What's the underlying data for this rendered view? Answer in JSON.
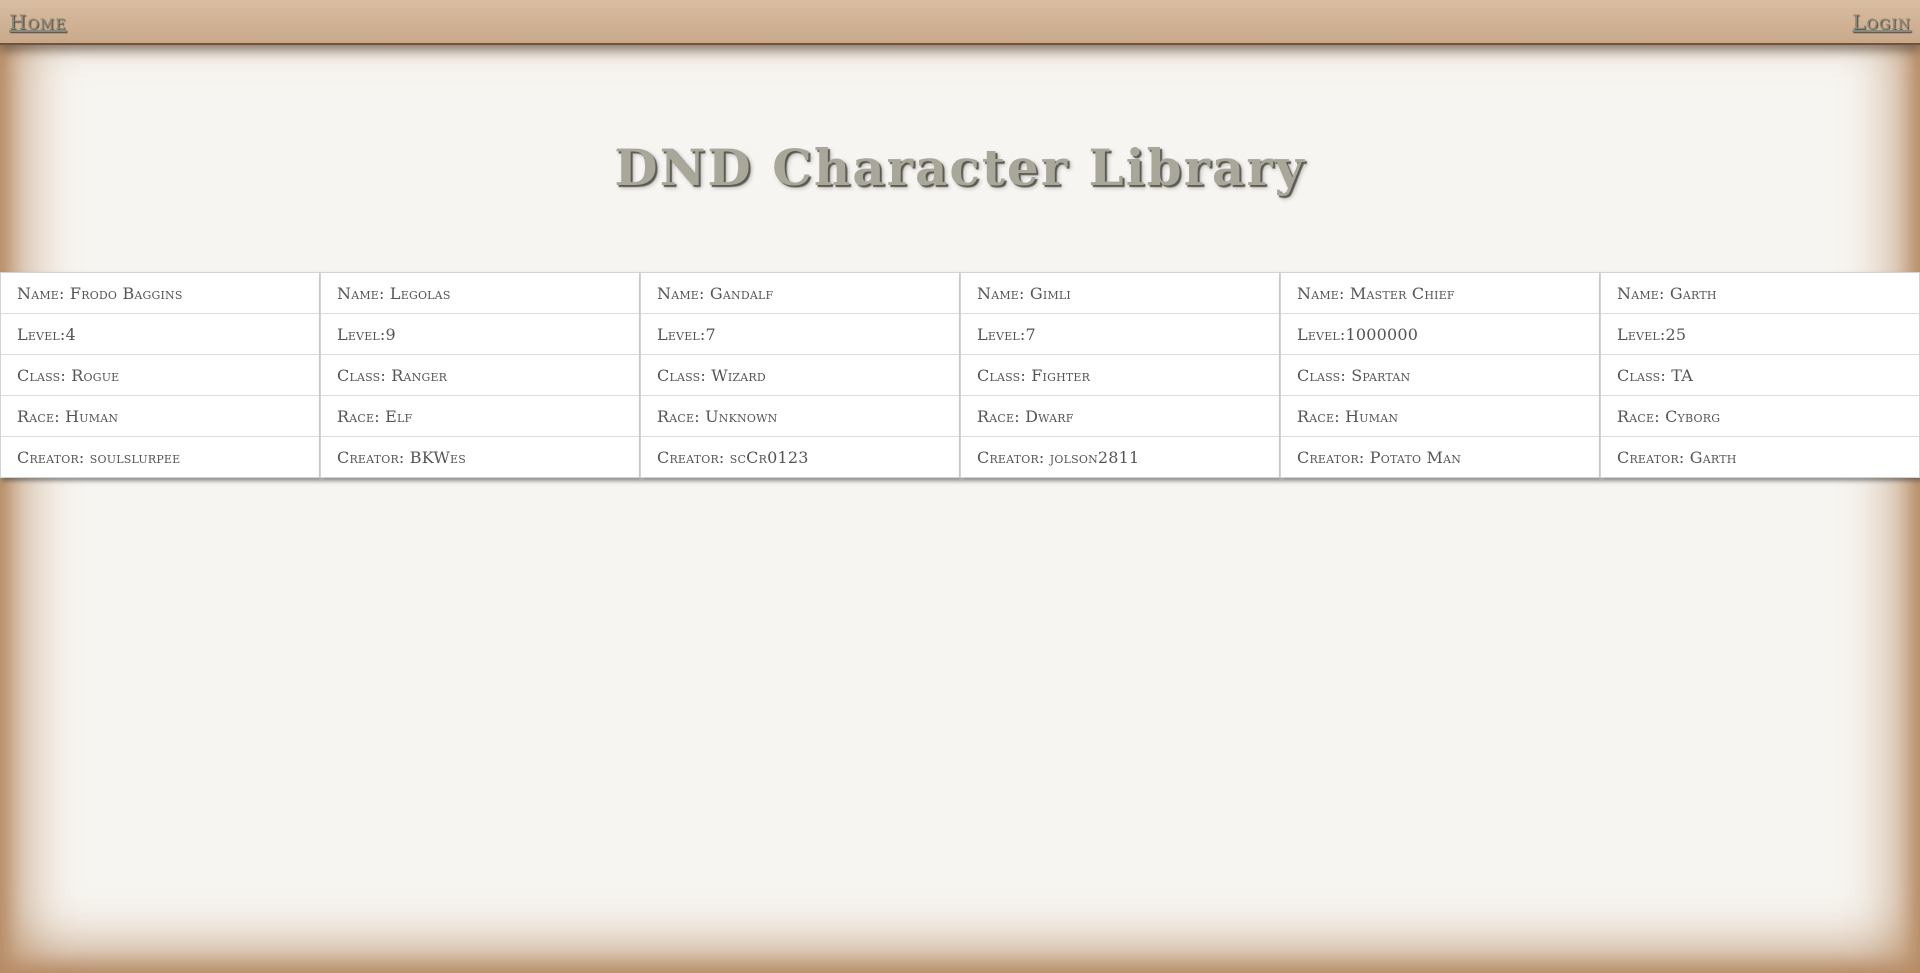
{
  "nav": {
    "home_label": "Home",
    "login_label": "Login"
  },
  "page": {
    "title": "DND Character Library"
  },
  "characters": [
    {
      "name": "Name: Frodo Baggins",
      "level": "Level:4",
      "class": "Class: Rogue",
      "race": "Race: Human",
      "creator": "Creator: soulslurpee"
    },
    {
      "name": "Name: Legolas",
      "level": "Level:9",
      "class": "Class: Ranger",
      "race": "Race: Elf",
      "creator": "Creator: BKWes"
    },
    {
      "name": "Name: Gandalf",
      "level": "Level:7",
      "class": "Class: Wizard",
      "race": "Race: Unknown",
      "creator": "Creator: scCr0123"
    },
    {
      "name": "Name: Gimli",
      "level": "Level:7",
      "class": "Class: Fighter",
      "race": "Race: Dwarf",
      "creator": "Creator: jolson2811"
    },
    {
      "name": "Name: Master Chief",
      "level": "Level:1000000",
      "class": "Class: Spartan",
      "race": "Race: Human",
      "creator": "Creator: Potato Man"
    },
    {
      "name": "Name: Garth",
      "level": "Level:25",
      "class": "Class: TA",
      "race": "Race: Cyborg",
      "creator": "Creator: Garth"
    }
  ],
  "colors": {
    "navbar": "#d2b498",
    "background": "#f7f5f1",
    "title": "#a8a79a",
    "border_vignette": "#b98e67"
  }
}
